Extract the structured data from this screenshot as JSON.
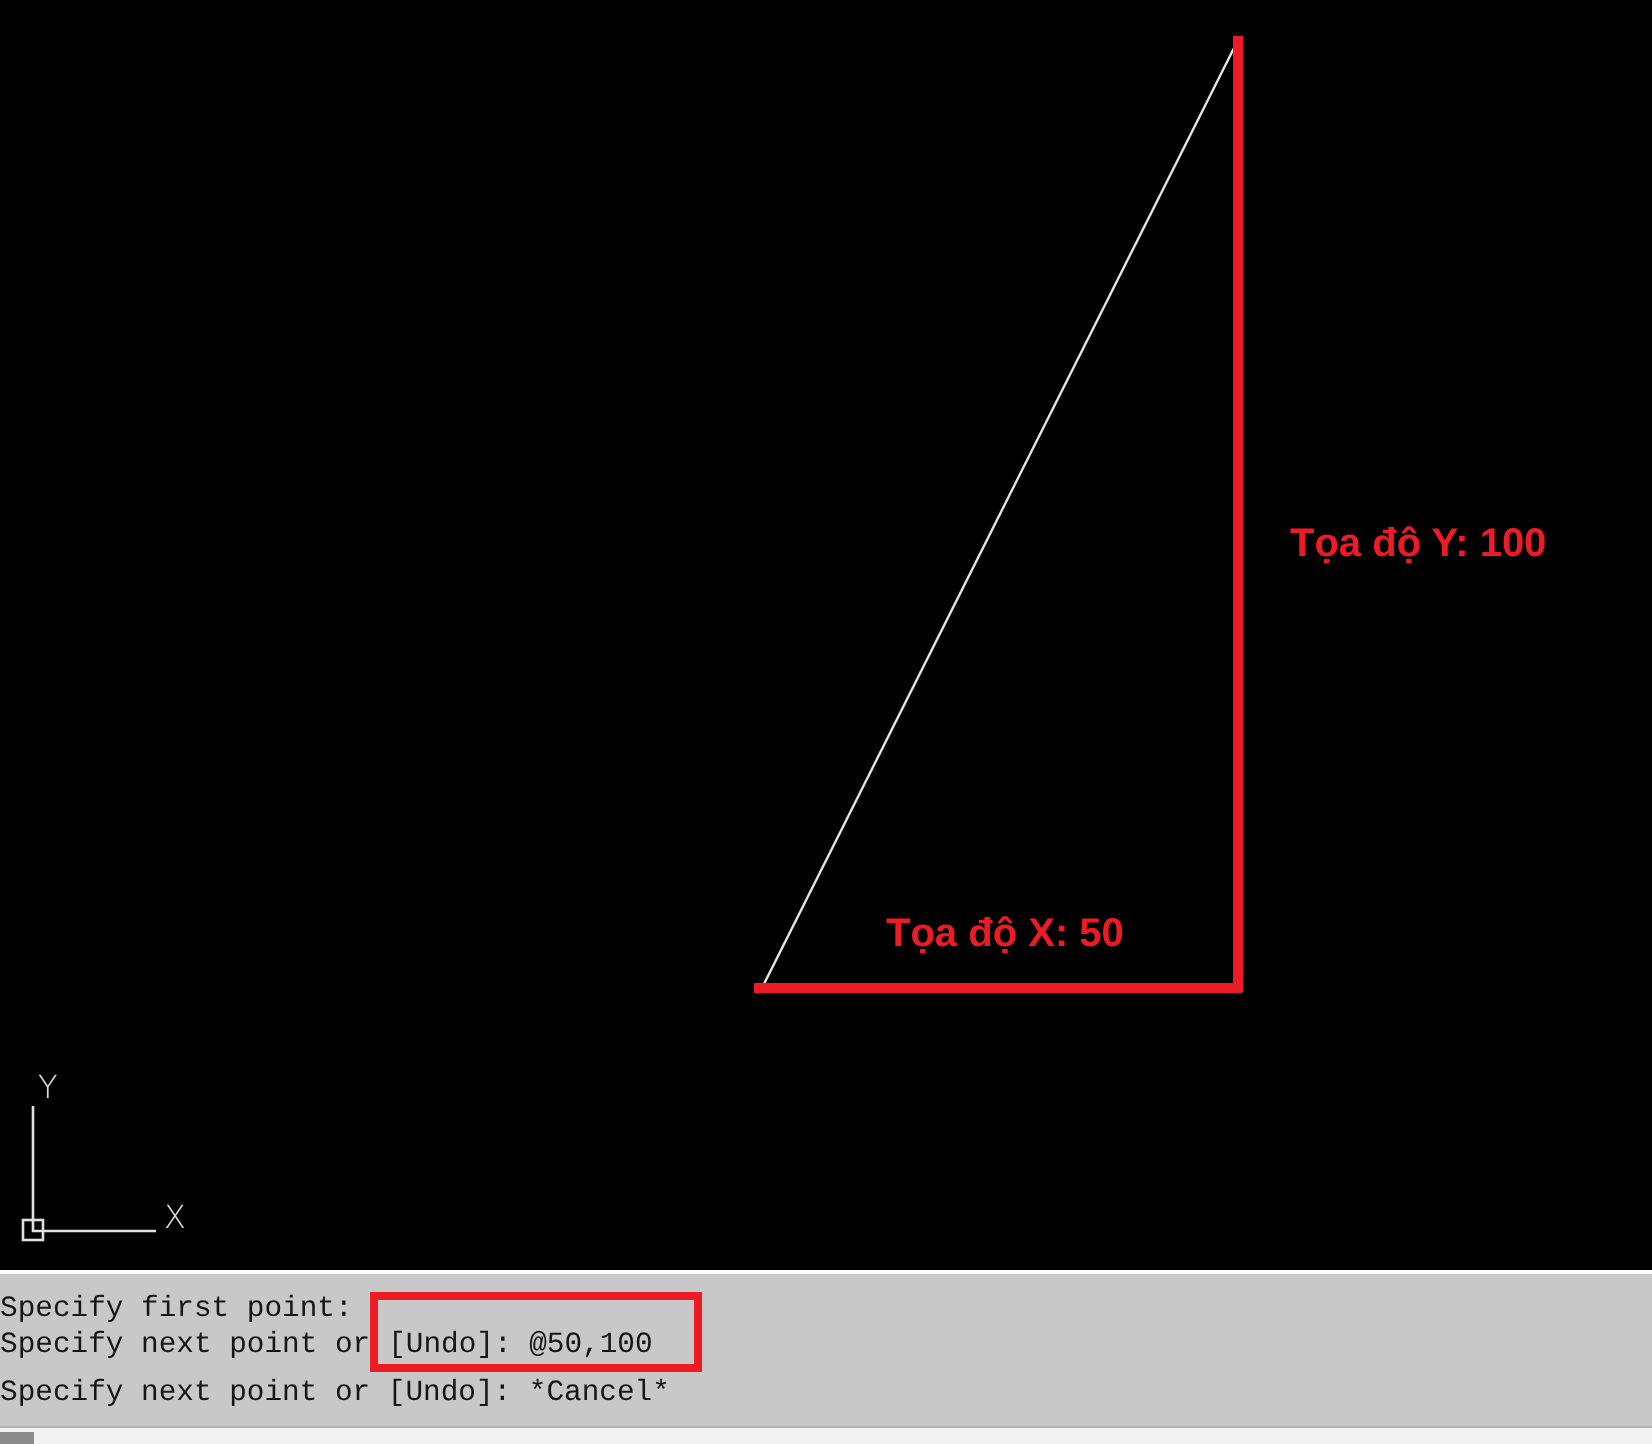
{
  "canvas": {
    "labels": [
      {
        "text": "Tọa độ Y: 100",
        "kind": "vertical"
      },
      {
        "text": "Tọa độ X: 50",
        "kind": "horizontal"
      }
    ],
    "ucs_icon": {
      "y_axis": "Y",
      "x_axis": "X"
    }
  },
  "command_history": {
    "lines": [
      {
        "text": "Specify first point:"
      },
      {
        "text": "Specify next point or",
        "highlight": "[Undo]: @50,100"
      },
      {
        "text": "Specify next point or [Undo]: *Cancel*"
      }
    ]
  }
}
